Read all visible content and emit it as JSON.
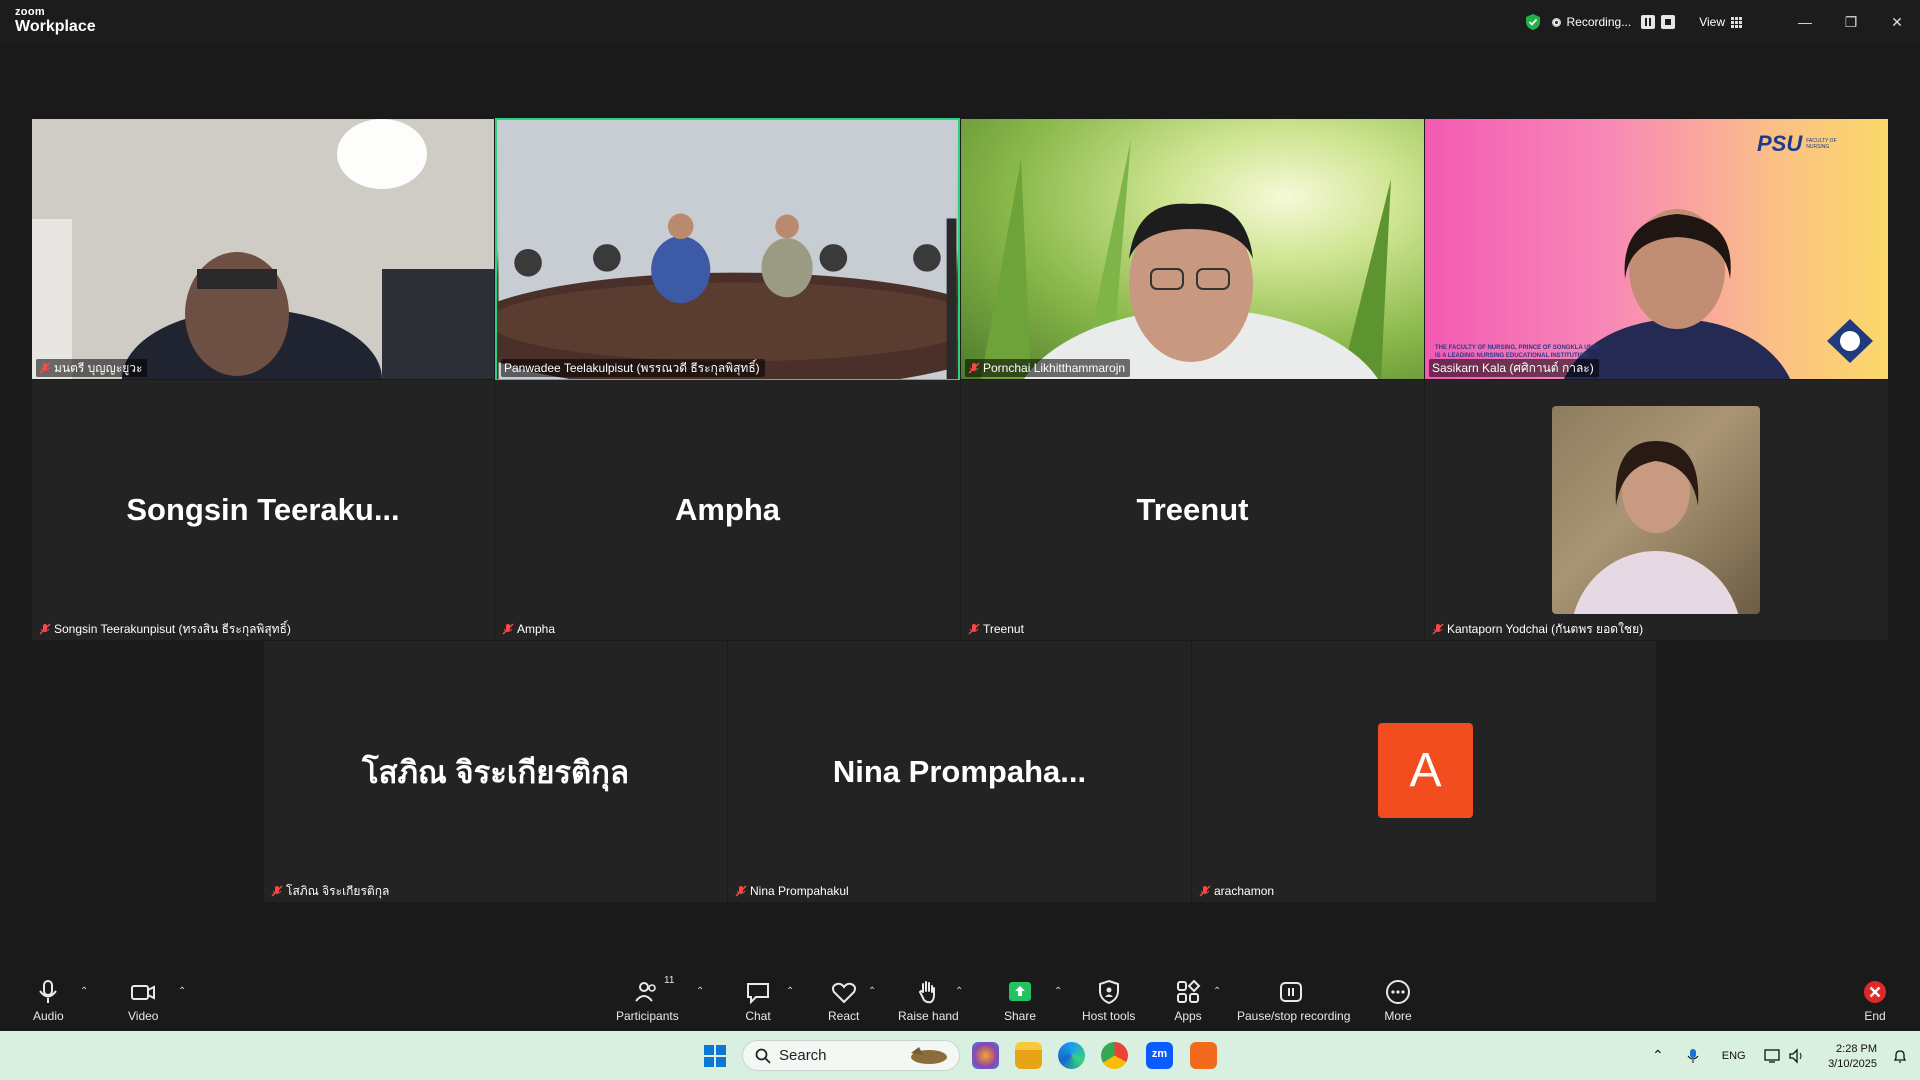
{
  "app": {
    "brand_top": "zoom",
    "brand_bottom": "Workplace"
  },
  "titlebar": {
    "recording_label": "Recording...",
    "view_label": "View"
  },
  "tiles": [
    {
      "name": "มนตรี บุญญะยูวะ"
    },
    {
      "name": "Panwadee Teelakulpisut (พรรณวดี ธีระกุลพิสุทธิ์)"
    },
    {
      "name": "Pornchai Likhitthammarojn"
    },
    {
      "name": "Sasikarn Kala (ศศิกานต์ กาละ)"
    },
    {
      "name": "Songsin Teerakunpisut (ทรงสิน ธีระกุลพิสุทธิ์)",
      "display": "Songsin  Teeraku..."
    },
    {
      "name": "Ampha",
      "display": "Ampha"
    },
    {
      "name": "Treenut",
      "display": "Treenut"
    },
    {
      "name": "Kantaporn Yodchai (กันตพร ยอดใชย)"
    },
    {
      "name": "โสภิณ จิระเกียรติกุล",
      "display": "โสภิณ  จิระเกียรติกุล"
    },
    {
      "name": "Nina Prompahakul",
      "display": "Nina  Prompaha..."
    },
    {
      "name": "arachamon",
      "initial": "A"
    }
  ],
  "psu_logo": {
    "title": "PSU",
    "line1": "FACULTY OF NURSING",
    "caption1": "THE FACULTY OF NURSING, PRINCE OF SONGKLA UNIV",
    "caption2": "IS A LEADING NURSING EDUCATIONAL INSTITUTION"
  },
  "toolbar": {
    "audio": "Audio",
    "video": "Video",
    "participants": "Participants",
    "participants_count": "11",
    "chat": "Chat",
    "react": "React",
    "raise_hand": "Raise hand",
    "share": "Share",
    "host_tools": "Host tools",
    "apps": "Apps",
    "pause_stop": "Pause/stop recording",
    "more": "More",
    "end": "End"
  },
  "taskbar": {
    "search_placeholder": "Search",
    "language": "ENG",
    "time": "2:28 PM",
    "date": "3/10/2025"
  },
  "colors": {
    "active_speaker": "#2bd17d",
    "avatar_a": "#f14d1e",
    "share_green": "#23c363",
    "end_red": "#e02828"
  }
}
